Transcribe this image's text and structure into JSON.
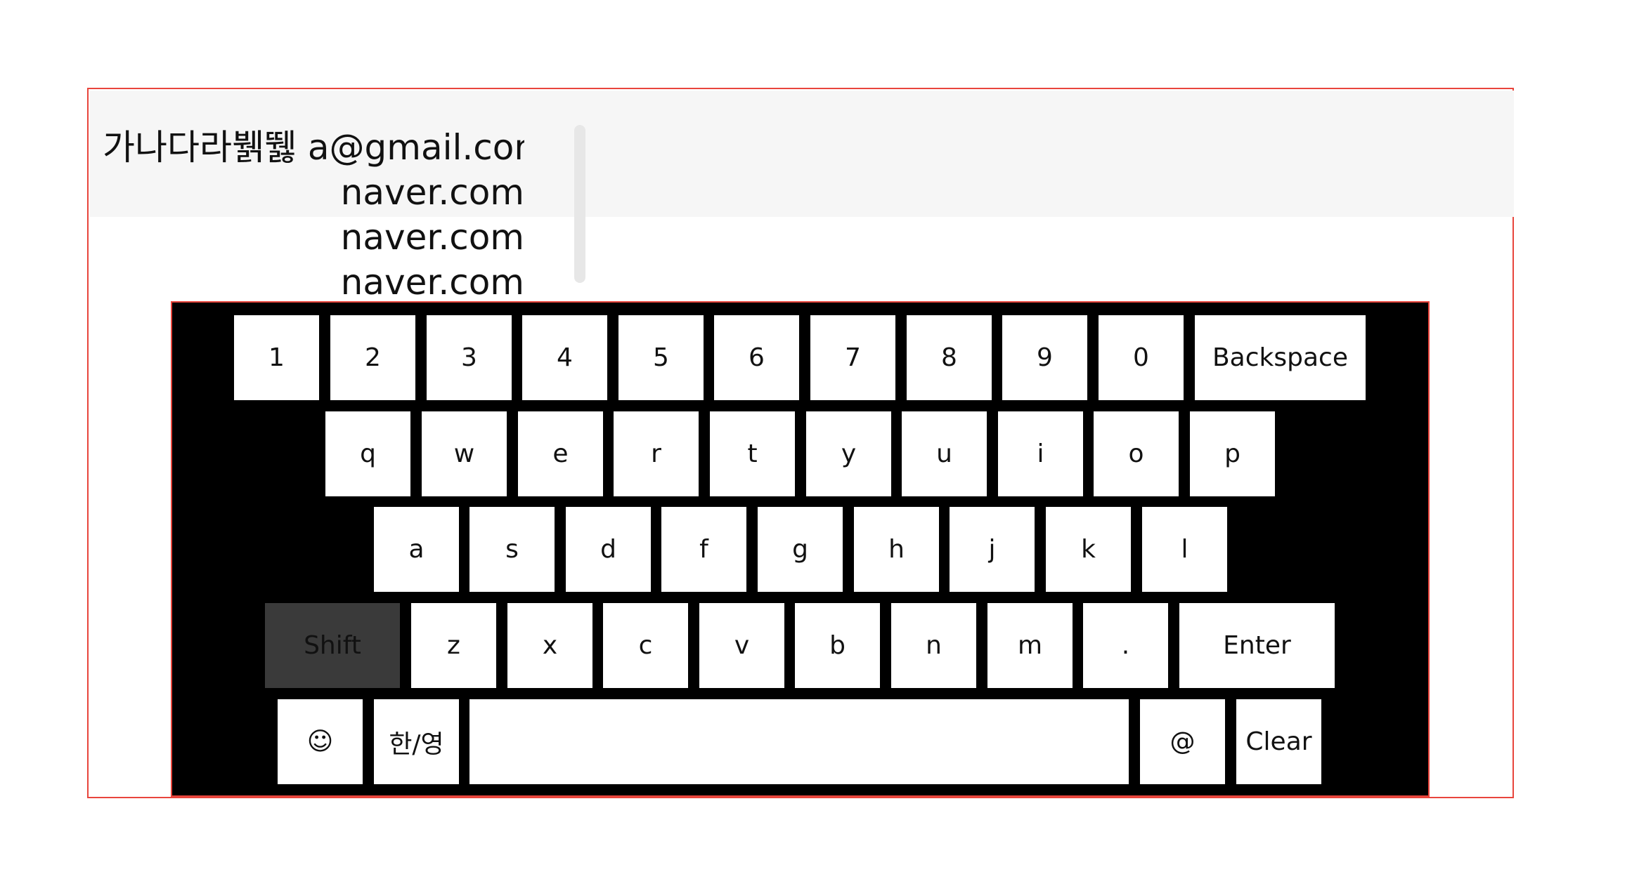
{
  "input": {
    "lines": [
      "가나다라뷁뛣 a@gmail.com",
      "naver.com",
      "naver.com",
      "naver.com"
    ]
  },
  "keyboard": {
    "row1": [
      "1",
      "2",
      "3",
      "4",
      "5",
      "6",
      "7",
      "8",
      "9",
      "0",
      "Backspace"
    ],
    "row2": [
      "q",
      "w",
      "e",
      "r",
      "t",
      "y",
      "u",
      "i",
      "o",
      "p"
    ],
    "row3": [
      "a",
      "s",
      "d",
      "f",
      "g",
      "h",
      "j",
      "k",
      "l"
    ],
    "row4": [
      "Shift",
      "z",
      "x",
      "c",
      "v",
      "b",
      "n",
      "m",
      ".",
      "Enter"
    ],
    "row5": [
      "☺",
      "한/영",
      "",
      "@",
      "Clear"
    ]
  },
  "colors": {
    "frame_border": "#e8453c",
    "keyboard_bg": "#000000",
    "key_bg": "#ffffff",
    "shift_active_bg": "#3a3a3a",
    "input_bg": "#f6f6f6"
  }
}
